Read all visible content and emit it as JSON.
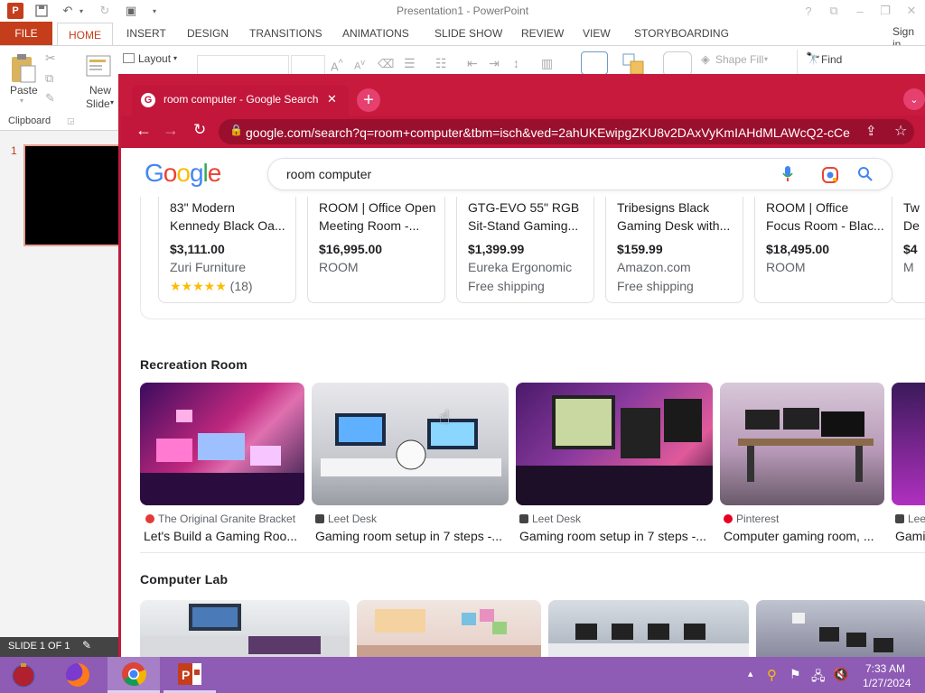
{
  "powerpoint": {
    "title": "Presentation1 - PowerPoint",
    "tabs": [
      "FILE",
      "HOME",
      "INSERT",
      "DESIGN",
      "TRANSITIONS",
      "ANIMATIONS",
      "SLIDE SHOW",
      "REVIEW",
      "VIEW",
      "STORYBOARDING"
    ],
    "sign_in": "Sign in",
    "ribbon": {
      "paste": "Paste",
      "new_slide_1": "New",
      "new_slide_2": "Slide",
      "layout": "Layout",
      "clipboard": "Clipboard",
      "shape_fill": "Shape Fill",
      "find": "Find"
    },
    "slide_number": "1",
    "status": "SLIDE 1 OF 1"
  },
  "chrome": {
    "tab_title": "room computer - Google Search",
    "url": "google.com/search?q=room+computer&tbm=isch&ved=2ahUKEwipgZKU8v2DAxVyKmIAHdMLAWcQ2-cCe..."
  },
  "google": {
    "logo": "Google",
    "query": "room computer",
    "products": [
      {
        "title1": "83\" Modern",
        "title2": "Kennedy Black Oa...",
        "price": "$3,111.00",
        "seller": "Zuri Furniture",
        "stars": "★★★★★",
        "reviews": "(18)"
      },
      {
        "title1": "ROOM | Office Open",
        "title2": "Meeting Room -...",
        "price": "$16,995.00",
        "seller": "ROOM",
        "extra": ""
      },
      {
        "title1": "GTG-EVO 55\" RGB",
        "title2": "Sit-Stand Gaming...",
        "price": "$1,399.99",
        "seller": "Eureka Ergonomic",
        "extra": "Free shipping"
      },
      {
        "title1": "Tribesigns Black",
        "title2": "Gaming Desk with...",
        "price": "$159.99",
        "seller": "Amazon.com",
        "extra": "Free shipping"
      },
      {
        "title1": "ROOM | Office",
        "title2": "Focus Room - Blac...",
        "price": "$18,495.00",
        "seller": "ROOM",
        "extra": ""
      },
      {
        "title1": "Tw",
        "title2": "De",
        "price": "$4",
        "seller": "M",
        "extra": ""
      }
    ],
    "section1": "Recreation Room",
    "section1_items": [
      {
        "source": "The Original Granite Bracket",
        "caption": "Let's Build a Gaming Roo..."
      },
      {
        "source": "Leet Desk",
        "caption": "Gaming room setup in 7 steps -..."
      },
      {
        "source": "Leet Desk",
        "caption": "Gaming room setup in 7 steps -..."
      },
      {
        "source": "Pinterest",
        "caption": "Computer gaming room, ..."
      },
      {
        "source": "Lee",
        "caption": "Gami"
      }
    ],
    "section2": "Computer Lab"
  },
  "taskbar": {
    "time": "7:33 AM",
    "date": "1/27/2024"
  }
}
